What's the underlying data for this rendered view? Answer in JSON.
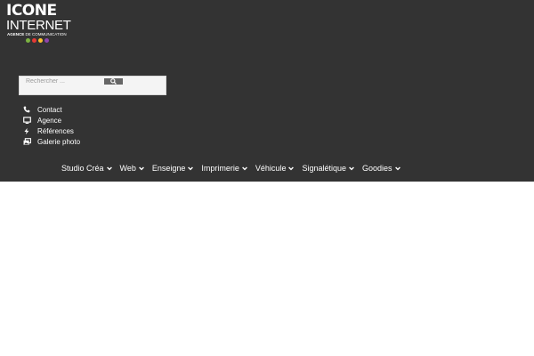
{
  "logo": {
    "line1": "ICONE",
    "line2": "INTERNET",
    "tag_bold": "AGENCE",
    "tag_rest": " DE COMMUNICATION",
    "dot_colors": [
      "#7cb342",
      "#e53935",
      "#fbc02d",
      "#8e44ad"
    ]
  },
  "search": {
    "placeholder": "Rechercher ..."
  },
  "links": [
    {
      "label": "Contact",
      "icon": "phone-icon"
    },
    {
      "label": "Agence",
      "icon": "monitor-icon"
    },
    {
      "label": "Références",
      "icon": "lightning-icon"
    },
    {
      "label": "Galerie photo",
      "icon": "images-icon"
    }
  ],
  "nav": [
    {
      "label": "Studio Créa"
    },
    {
      "label": "Web"
    },
    {
      "label": "Enseigne"
    },
    {
      "label": "Imprimerie"
    },
    {
      "label": "Véhicule"
    },
    {
      "label": "Signalétique"
    },
    {
      "label": "Goodies"
    }
  ],
  "colors": {
    "header_bg": "#333333",
    "page_bg": "#ffffff",
    "text": "#ffffff",
    "search_button": "#666666"
  }
}
